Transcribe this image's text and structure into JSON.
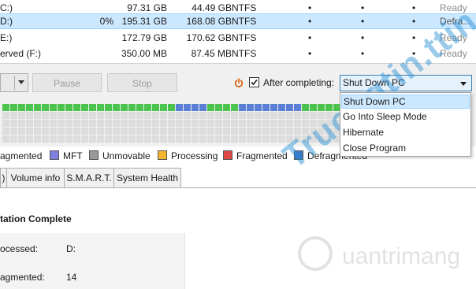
{
  "drives": [
    {
      "name": "C:)",
      "percent": "",
      "capacity": "97.31 GB",
      "free": "44.49 GB",
      "fs": "NTFS",
      "status": "Ready",
      "selected": false
    },
    {
      "name": "D:)",
      "percent": "0%",
      "capacity": "195.31 GB",
      "free": "168.08 GB",
      "fs": "NTFS",
      "status": "Defra...",
      "selected": true
    },
    {
      "name": "E:)",
      "percent": "",
      "capacity": "172.79 GB",
      "free": "170.62 GB",
      "fs": "NTFS",
      "status": "Ready",
      "selected": false
    },
    {
      "name": "erved (F:)",
      "percent": "",
      "capacity": "350.00 MB",
      "free": "87.45 MB",
      "fs": "NTFS",
      "status": "Ready",
      "selected": false
    }
  ],
  "toolbar": {
    "pause_label": "Pause",
    "stop_label": "Stop",
    "power_icon": "power-icon",
    "after_completing_label": "After completing:",
    "after_completing_checked": true,
    "after_completing_value": "Shut Down PC"
  },
  "dropdown": {
    "options": [
      "Shut Down PC",
      "Go Into Sleep Mode",
      "Hibernate",
      "Close Program"
    ],
    "highlighted": "Shut Down PC"
  },
  "legend": [
    {
      "label": "agmented",
      "color": null
    },
    {
      "label": "MFT",
      "color": "#8080e0"
    },
    {
      "label": "Unmovable",
      "color": "#999999"
    },
    {
      "label": "Processing",
      "color": "#f5b632"
    },
    {
      "label": "Fragmented",
      "color": "#e04848"
    },
    {
      "label": "Defragmented",
      "color": "#3c78c8"
    }
  ],
  "tabs": [
    ")",
    "Volume info",
    "S.M.A.R.T.",
    "System Health"
  ],
  "panel": {
    "heading": "tation Complete",
    "rows": [
      {
        "label": "ocessed:",
        "value": "D:"
      },
      {
        "label": "agmented:",
        "value": "14"
      }
    ]
  },
  "colors": {
    "selection_bg": "#cce8ff",
    "cluster_used": "#4cc34c",
    "cluster_moved": "#5c7fd6",
    "cluster_free": "#dcdcdc",
    "power_icon": "#e05a00"
  },
  "cluster_map": {
    "row1": "ggggggggggggggggggggggbbbbggggbbbbbbbbgggggggggbbbbggggg"
  },
  "watermark": {
    "text": "Truongtin.ttin",
    "brand": "uantrimang"
  }
}
